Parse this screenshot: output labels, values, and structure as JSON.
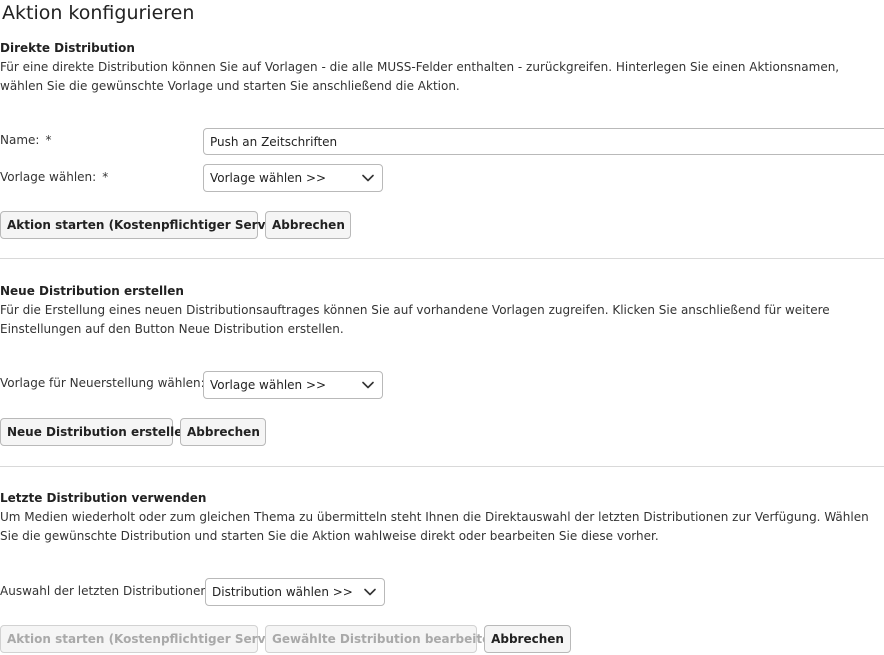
{
  "page": {
    "title": "Aktion konfigurieren"
  },
  "direct": {
    "title": "Direkte Distribution",
    "description": "Für eine direkte Distribution können Sie auf Vorlagen - die alle MUSS-Felder enthalten - zurückgreifen. Hinterlegen Sie einen Aktionsnamen, wählen Sie die gewünschte Vorlage und starten Sie anschließend die Aktion.",
    "name_label": "Name:",
    "name_value": "Push an Zeitschriften",
    "template_label": "Vorlage wählen:",
    "template_selected": "Vorlage wählen >>",
    "required_marker": "*",
    "start_button": "Aktion starten (Kostenpflichtiger Service)",
    "cancel_button": "Abbrechen"
  },
  "new_distribution": {
    "title": "Neue Distribution erstellen",
    "description": "Für die Erstellung eines neuen Distributionsauftrages können Sie auf vorhandene Vorlagen zugreifen. Klicken Sie anschließend für weitere Einstellungen auf den Button Neue Distribution erstellen.",
    "template_label": "Vorlage für Neuerstellung wählen:",
    "template_selected": "Vorlage wählen >>",
    "create_button": "Neue Distribution erstellen",
    "cancel_button": "Abbrechen"
  },
  "last_distribution": {
    "title": "Letzte Distribution verwenden",
    "description": "Um Medien wiederholt oder zum gleichen Thema zu übermitteln steht Ihnen die Direktauswahl der letzten Distributionen zur Verfügung. Wählen Sie die gewünschte Distribution und starten Sie die Aktion wahlweise direkt oder bearbeiten Sie diese vorher.",
    "select_label": "Auswahl der letzten Distributionen:",
    "select_selected": "Distribution wählen >>",
    "start_button": "Aktion starten (Kostenpflichtiger Service)",
    "edit_button": "Gewählte Distribution bearbeiten",
    "cancel_button": "Abbrechen"
  },
  "icons": {
    "select_chevron": "chevron-down-icon"
  }
}
